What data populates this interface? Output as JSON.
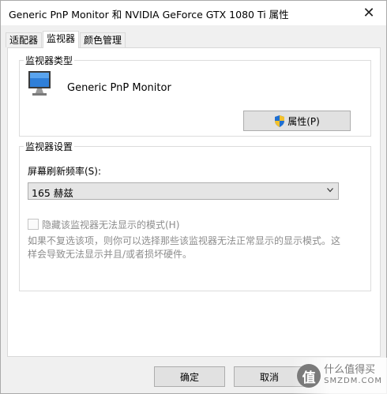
{
  "window": {
    "title": "Generic PnP Monitor 和 NVIDIA GeForce GTX 1080 Ti 属性",
    "close_glyph": "✕"
  },
  "tabs": [
    {
      "label": "适配器",
      "active": false
    },
    {
      "label": "监视器",
      "active": true
    },
    {
      "label": "颜色管理",
      "active": false
    }
  ],
  "monitor_type": {
    "group_label": "监视器类型",
    "icon": "monitor-icon",
    "monitor_name": "Generic PnP Monitor",
    "properties_button": "属性(P)",
    "properties_icon": "uac-shield-icon"
  },
  "monitor_settings": {
    "group_label": "监视器设置",
    "refresh_label": "屏幕刷新频率(S):",
    "refresh_value": "165 赫兹",
    "hide_modes_label": "隐藏该监视器无法显示的模式(H)",
    "hide_modes_checked": false,
    "hide_modes_enabled": false,
    "description": "如果不复选该项，则你可以选择那些该监视器无法正常显示的显示模式。这样会导致无法显示并且/或者损坏硬件。"
  },
  "buttons": {
    "ok": "确定",
    "cancel": "取消"
  },
  "watermark": {
    "glyph": "值",
    "top": "什么值得买",
    "bottom": "SMZDM.COM"
  },
  "colors": {
    "accent": "#0078d7",
    "disabled_text": "#8d8d8d",
    "button_face": "#e1e1e1"
  }
}
